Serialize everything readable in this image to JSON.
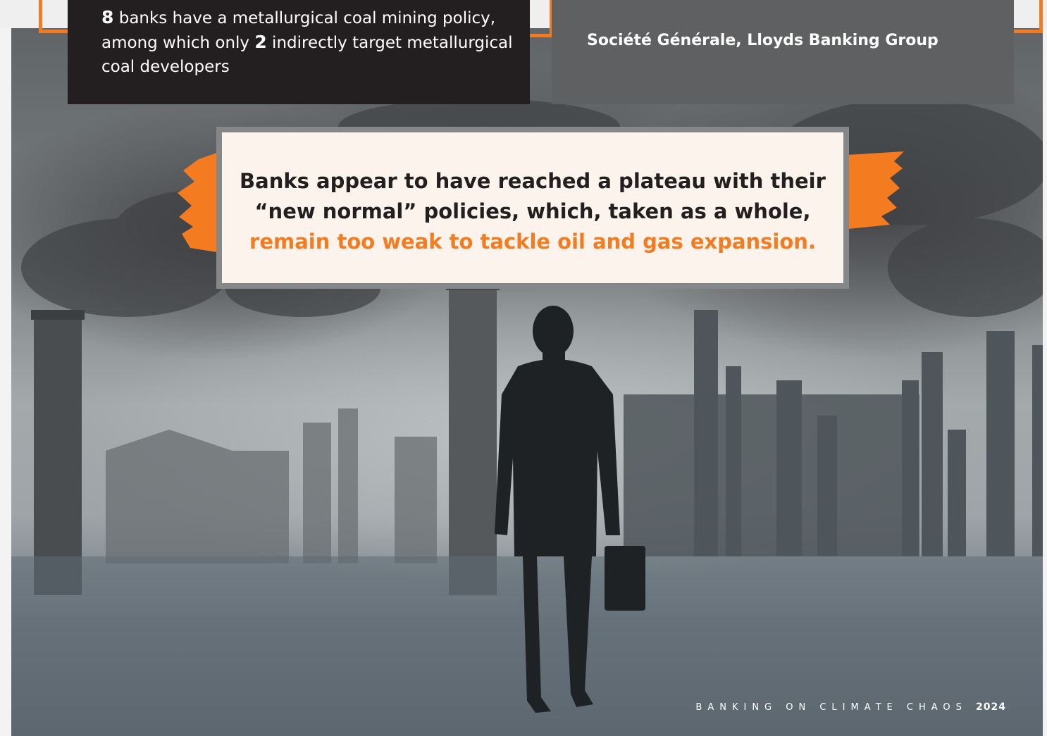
{
  "left_box": {
    "count_a": "8",
    "line_a": " banks have a metallurgical coal mining policy, among which only ",
    "count_b": "2",
    "line_b": " indirectly target metallurgical coal developers"
  },
  "right_box": {
    "banks": "Société Générale, Lloyds Banking Group"
  },
  "callout": {
    "line1": "Banks appear to have reached a plateau with their",
    "line2": "“new normal” policies, which, taken as a whole,",
    "highlight": "remain too weak to tackle oil and gas expansion."
  },
  "footer": {
    "title": "BANKING ON CLIMATE CHAOS",
    "year": "2024"
  },
  "colors": {
    "accent": "#f47b20",
    "dark_box": "#231f20",
    "grey_box": "#5f6062",
    "callout_bg": "#fbf3ec"
  }
}
